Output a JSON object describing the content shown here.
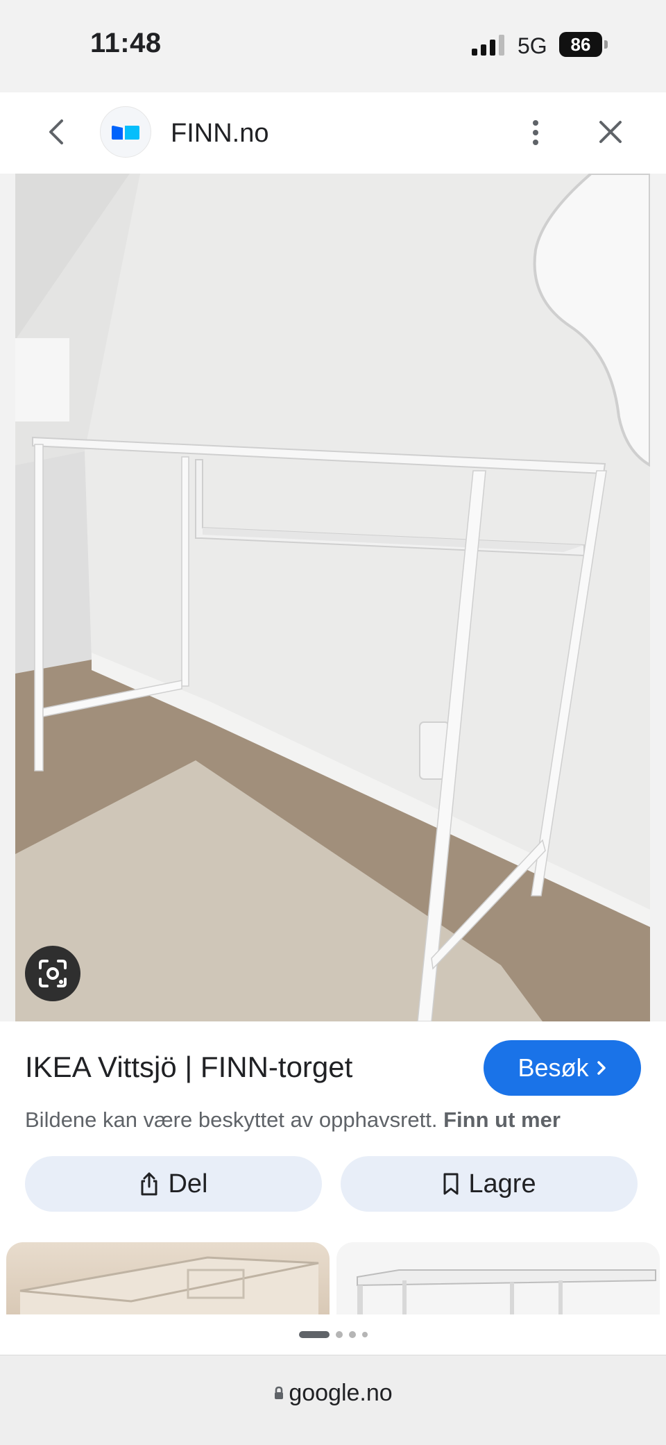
{
  "status_bar": {
    "time": "11:48",
    "network": "5G",
    "battery": "86"
  },
  "header": {
    "site_name": "FINN.no",
    "logo_colors": [
      "#0063fb",
      "#06befb"
    ]
  },
  "result": {
    "title": "IKEA Vittsjö | FINN-torget",
    "visit_label": "Besøk",
    "copyright_text": "Bildene kan være beskyttet av opphavsrett.",
    "learn_more": "Finn ut mer",
    "share_label": "Del",
    "save_label": "Lagre"
  },
  "url_bar": {
    "domain": "google.no"
  },
  "colors": {
    "accent": "#1a73e8",
    "action_bg": "#e8eef8"
  },
  "pager": {
    "active_index": 0,
    "count": 4
  }
}
